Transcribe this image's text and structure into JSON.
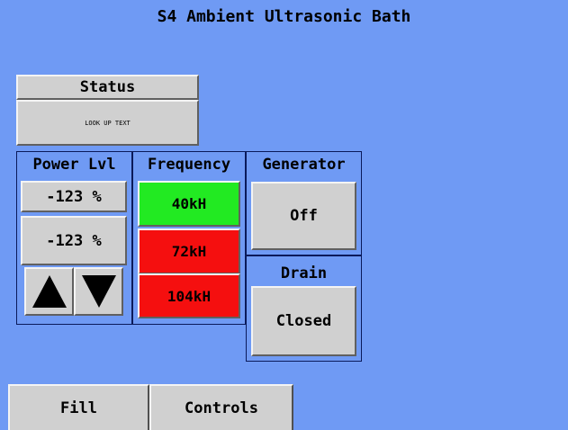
{
  "title": "S4 Ambient Ultrasonic Bath",
  "status": {
    "header": "Status",
    "text": "LOOK UP TEXT"
  },
  "power": {
    "header": "Power Lvl",
    "value1": "-123 %",
    "value2": "-123 %"
  },
  "frequency": {
    "header": "Frequency",
    "options": [
      "40kH",
      "72kH",
      "104kH"
    ],
    "selected": "40kH",
    "colors": {
      "selected": "#22ea22",
      "unselected": "#f50f0f"
    }
  },
  "generator": {
    "header": "Generator",
    "state": "Off"
  },
  "drain": {
    "header": "Drain",
    "state": "Closed"
  },
  "tabs": [
    "Fill",
    "Controls"
  ],
  "colors": {
    "background": "#6f9af4",
    "button": "#d0d0d0"
  },
  "icons": [
    "arrow-up-icon",
    "arrow-down-icon"
  ]
}
